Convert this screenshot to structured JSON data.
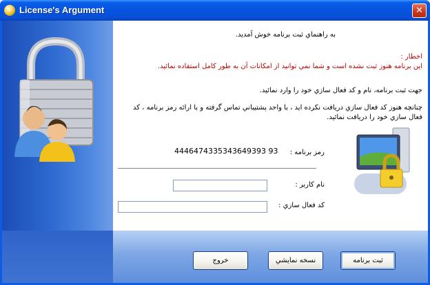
{
  "window": {
    "title": "License's Argument",
    "app_icon": "app-icon",
    "close_icon": "close-icon"
  },
  "dialog": {
    "welcome": "به راهنماي ثبت  برنامه خوش آمديد.",
    "warning_title": "اخطار :",
    "warning_body": "اين برنامه هنوز ثبت نشده است و شما نمي توانيد از امکانات آن به طور کامل استفاده نمائيد.",
    "instruction": "جهت ثبت برنامه، نام و کد فعال سازي خود را وارد نمائيد.",
    "contact_note": "چنانچه هنوز کد فعال سازي دريافت نکرده ايد ، با واحد پشتيباني تماس گرفته و با ارائه رمز برنامه ، کد فعال سازي خود را دريافت نمائيد.",
    "program_code_label": "رمز برنامه :",
    "program_code_value": "4446474335343649393 93",
    "username_label": "نام کاربر :",
    "username_value": "",
    "activation_code_label": "کد فعال سازي :",
    "activation_code_value": ""
  },
  "buttons": {
    "register": "ثبت برنامه",
    "demo": "نسخه نمايشي",
    "exit": "خروج"
  },
  "colors": {
    "warning": "#c00000",
    "titlebar": "#0554e0",
    "accent_blue": "#2e6ad0"
  },
  "icons": {
    "left_illustration": "padlock-with-users-icon",
    "right_illustration": "computer-lock-icon"
  }
}
